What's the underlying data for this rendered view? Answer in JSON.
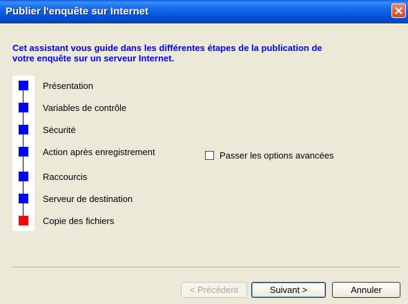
{
  "window": {
    "title": "Publier l'enquête sur Internet"
  },
  "intro": "Cet assistant vous guide dans les différentes étapes de la publication de votre enquête sur un serveur Internet.",
  "steps": [
    {
      "label": "Présentation",
      "status": "done"
    },
    {
      "label": "Variables de contrôle",
      "status": "done"
    },
    {
      "label": "Sécurité",
      "status": "done"
    },
    {
      "label": "Action après enregistrement",
      "status": "done"
    },
    {
      "label": "Raccourcis",
      "status": "done"
    },
    {
      "label": "Serveur de destination",
      "status": "done"
    },
    {
      "label": "Copie des fichiers",
      "status": "current"
    }
  ],
  "options": {
    "skip_advanced_label": "Passer les options avancées",
    "skip_advanced_checked": false
  },
  "buttons": {
    "previous": "< Précédent",
    "next": "Suivant >",
    "cancel": "Annuler"
  },
  "colors": {
    "step_done": "#0000ff",
    "step_current": "#ff0000",
    "title_bar": "#0552dc"
  }
}
